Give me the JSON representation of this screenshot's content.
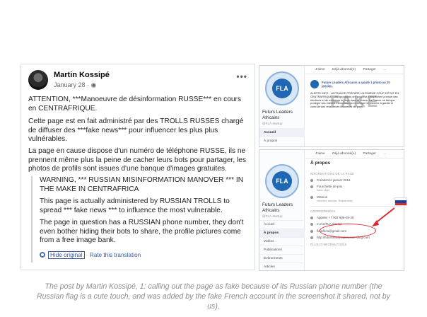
{
  "post": {
    "author": "Martin Kossipé",
    "date": "January 28 · ",
    "menu": "•••",
    "para1": "ATTENTION, ***Manoeuvre de désinformation RUSSE*** en cours en CENTRAFRIQUE.",
    "para2": "Cette page est en fait administré par des TROLLS RUSSES chargé de diffuser des ***fake news*** pour influencer les plus plus vulnérables.",
    "para3": "La page en cause dispose d'un numéro de téléphone RUSSE, ils ne prennent même plus la peine de cacher leurs bots pour partager, les photos de profils sont issues d'une banque d'images gratuites.",
    "tr1": "WARNING, *** RUSSIAN MISINFORMATION MANOVER *** IN THE MAKE IN CENTRAFRICA",
    "tr2": "This page is actually administered by RUSSIAN TROLLS to spread *** fake news *** to influence the most vulnerable.",
    "tr3": "The page in question has a RUSSIAN phone number, they don't even bother hiding their bots to share, the profile pictures come from a free image bank.",
    "hide_original": "Hide original",
    "separator": "·",
    "rate": "Rate this translation"
  },
  "top_shot": {
    "logo": "FLA",
    "page_name": "Futurs Leaders Africains",
    "handle": "@FLA.startup",
    "nav": [
      "Accueil",
      "À propos"
    ],
    "toolbar": [
      "J'aime",
      "Déjà abonné(e)",
      "Partager",
      "..."
    ],
    "post_title": "Future Leaders Africains a ajouté 1 photo au 20 janvier.",
    "post_time": "20 janvier · ",
    "post_body": "ALERTE INFO : LA FRANCE PRÉPARE UN ÉNIEME COUP D'ÉTAT EN CENTRAFRIQUE. Les opposants ont pour but d'empêcher la tenue des élections et de maintenir le pays dans le chaos. La France ne fait que protéger ses intérêts économiques en Afrique et cherche à garder le contrôle des ressources naturelles du pays...",
    "watermark": "FAKE"
  },
  "bottom_shot": {
    "logo": "FLA",
    "page_name": "Futurs Leaders Africains",
    "handle": "@FLA.startup",
    "nav": [
      "Accueil",
      "À propos",
      "Vidéos",
      "Publications",
      "Évènements",
      "Articles"
    ],
    "toolbar": [
      "J'aime",
      "Déjà abonné(e)",
      "Partager",
      "..."
    ],
    "title": "À propos",
    "section_info": "INFORMATIONS DE LA PAGE",
    "created": "Création le janvier 2016",
    "price": "Fourchette de prix",
    "price_sub": "Sans objet",
    "mission": "Mission",
    "mission_sub": "Informer, amuser, Rassembler",
    "section_contact": "COORDONNÉES",
    "phone": "Appeler +7 902 606-09-30",
    "messenger": "m.me/FLA.startup",
    "email": "fla.africa@gmail.com",
    "website": "http://futurslesafricains.over-blog.com",
    "section_more": "PLUS D'INFORMATIONS"
  },
  "caption": "The post by Martin Kossipé, 1: calling out the page as fake because of its Russian phone number (the Russian flag is a cute touch, and was added by the fake French account in the screenshot it shared, not by us).",
  "colors": {
    "fb_blue": "#385898",
    "logo_blue": "#1f67b2",
    "annotation_red": "#e0242b",
    "caption_gray": "#8e8e8e"
  }
}
